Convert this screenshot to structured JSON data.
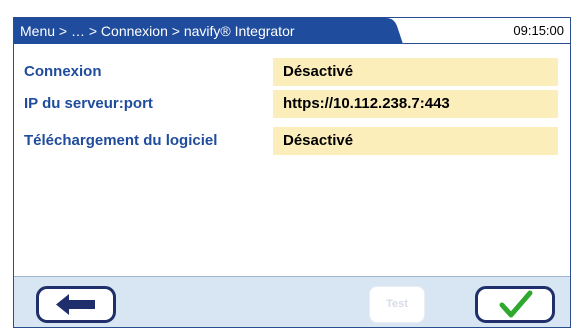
{
  "header": {
    "breadcrumb": "Menu > … > Connexion > navify® Integrator",
    "time": "09:15:00"
  },
  "settings": [
    {
      "label": "Connexion",
      "value": "Désactivé"
    },
    {
      "label": "IP du serveur:port",
      "value": "https://10.112.238.7:443"
    },
    {
      "label": "Téléchargement du logiciel",
      "value": "Désactivé"
    }
  ],
  "footer": {
    "back_icon": "arrow-left-icon",
    "test_label": "Test",
    "test_enabled": false,
    "confirm_icon": "checkmark-icon"
  },
  "colors": {
    "header_blue": "#1f4c9c",
    "label_blue": "#1f4c9c",
    "value_bg": "#fbeebb",
    "footer_bg": "#d8e5f2",
    "confirm_green": "#2ea82e"
  }
}
